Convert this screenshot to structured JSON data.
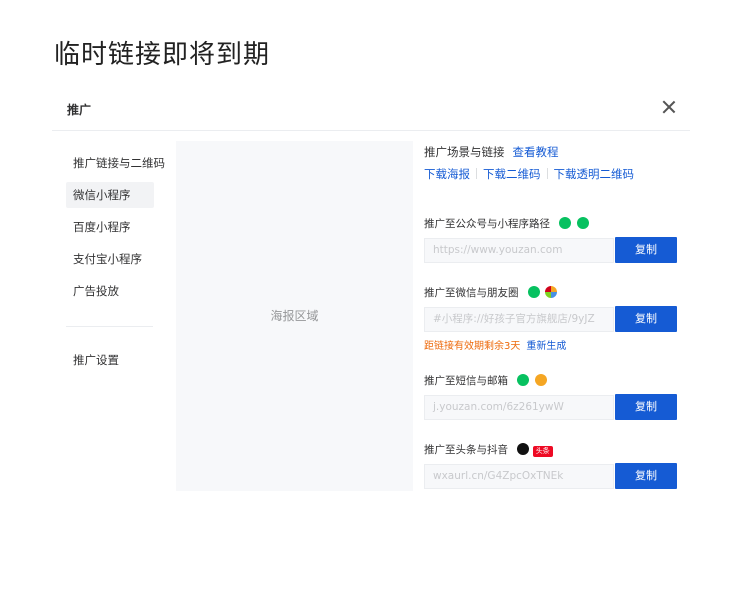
{
  "page_title": "临时链接即将到期",
  "dialog": {
    "title": "推广",
    "close_icon": "close-icon"
  },
  "sidebar": {
    "items": [
      {
        "label": "推广链接与二维码",
        "active": false
      },
      {
        "label": "微信小程序",
        "active": true
      },
      {
        "label": "百度小程序",
        "active": false
      },
      {
        "label": "支付宝小程序",
        "active": false
      },
      {
        "label": "广告投放",
        "active": false
      }
    ],
    "settings_label": "推广设置"
  },
  "poster": {
    "label": "海报区域"
  },
  "scene": {
    "label": "推广场景与链接",
    "tutorial_link": "查看教程",
    "downloads": [
      "下载海报",
      "下载二维码",
      "下载透明二维码"
    ]
  },
  "sections": [
    {
      "label": "推广至公众号与小程序路径",
      "icons": [
        "wechat-official-icon",
        "mini-program-icon"
      ],
      "placeholder": "https://www.youzan.com",
      "copy_label": "复制"
    },
    {
      "label": "推广至微信与朋友圈",
      "icons": [
        "wechat-icon",
        "moments-icon"
      ],
      "placeholder": "#小程序://好孩子官方旗舰店/9yJZ",
      "copy_label": "复制"
    },
    {
      "label": "推广至短信与邮箱",
      "icons": [
        "sms-icon",
        "mail-icon"
      ],
      "placeholder": "j.youzan.com/6z261ywW",
      "copy_label": "复制"
    },
    {
      "label": "推广至头条与抖音",
      "icons": [
        "douyin-icon",
        "toutiao-icon"
      ],
      "tag": "头条",
      "placeholder": "wxaurl.cn/G4ZpcOxTNEk",
      "copy_label": "复制"
    }
  ],
  "expire_note": {
    "text": "距链接有效期剩余3天",
    "regenerate": "重新生成"
  },
  "colors": {
    "primary": "#155bd4",
    "warning": "#ed6a0c",
    "wechat_green": "#07c160",
    "border": "#ebedf0"
  }
}
